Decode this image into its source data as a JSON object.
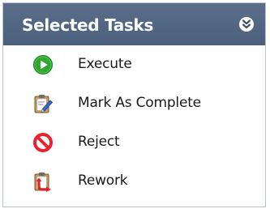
{
  "panel": {
    "title": "Selected Tasks",
    "collapse_icon": "double-chevron-down-icon"
  },
  "items": [
    {
      "label": "Execute",
      "icon": "play-icon"
    },
    {
      "label": "Mark As Complete",
      "icon": "clipboard-edit-icon"
    },
    {
      "label": "Reject",
      "icon": "no-entry-icon"
    },
    {
      "label": "Rework",
      "icon": "clipboard-rework-icon"
    }
  ],
  "colors": {
    "header": "#4f6582",
    "play": "#2fa832",
    "reject": "#e8232d",
    "clipboard": "#b5874a"
  }
}
